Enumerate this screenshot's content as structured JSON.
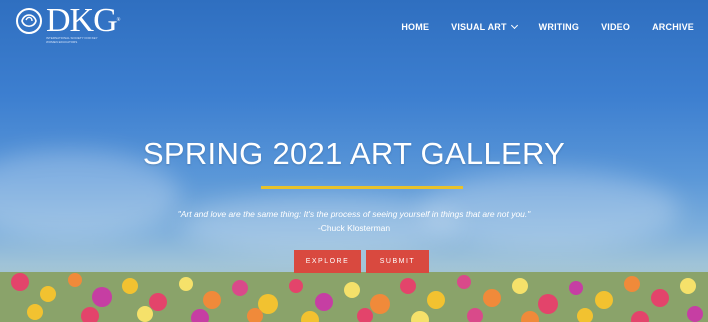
{
  "logo": {
    "text": "DKG",
    "tm": "®",
    "subtitle": "INTERNATIONAL SOCIETY FOR KEY WOMEN EDUCATORS",
    "icon": "rose-icon"
  },
  "nav": {
    "items": [
      {
        "label": "HOME"
      },
      {
        "label": "VISUAL ART",
        "has_dropdown": true
      },
      {
        "label": "WRITING"
      },
      {
        "label": "VIDEO"
      },
      {
        "label": "ARCHIVE"
      }
    ]
  },
  "hero": {
    "title": "SPRING 2021 ART GALLERY",
    "quote": "\"Art and love are the same thing: It's the process of seeing yourself in things that are not you.\"",
    "author": "-Chuck Klosterman",
    "buttons": {
      "explore": "EXPLORE",
      "submit": "SUBMIT"
    }
  },
  "colors": {
    "accent_rule": "#e8c22a",
    "button": "#d9493f",
    "sky": "#3d7fd0"
  }
}
